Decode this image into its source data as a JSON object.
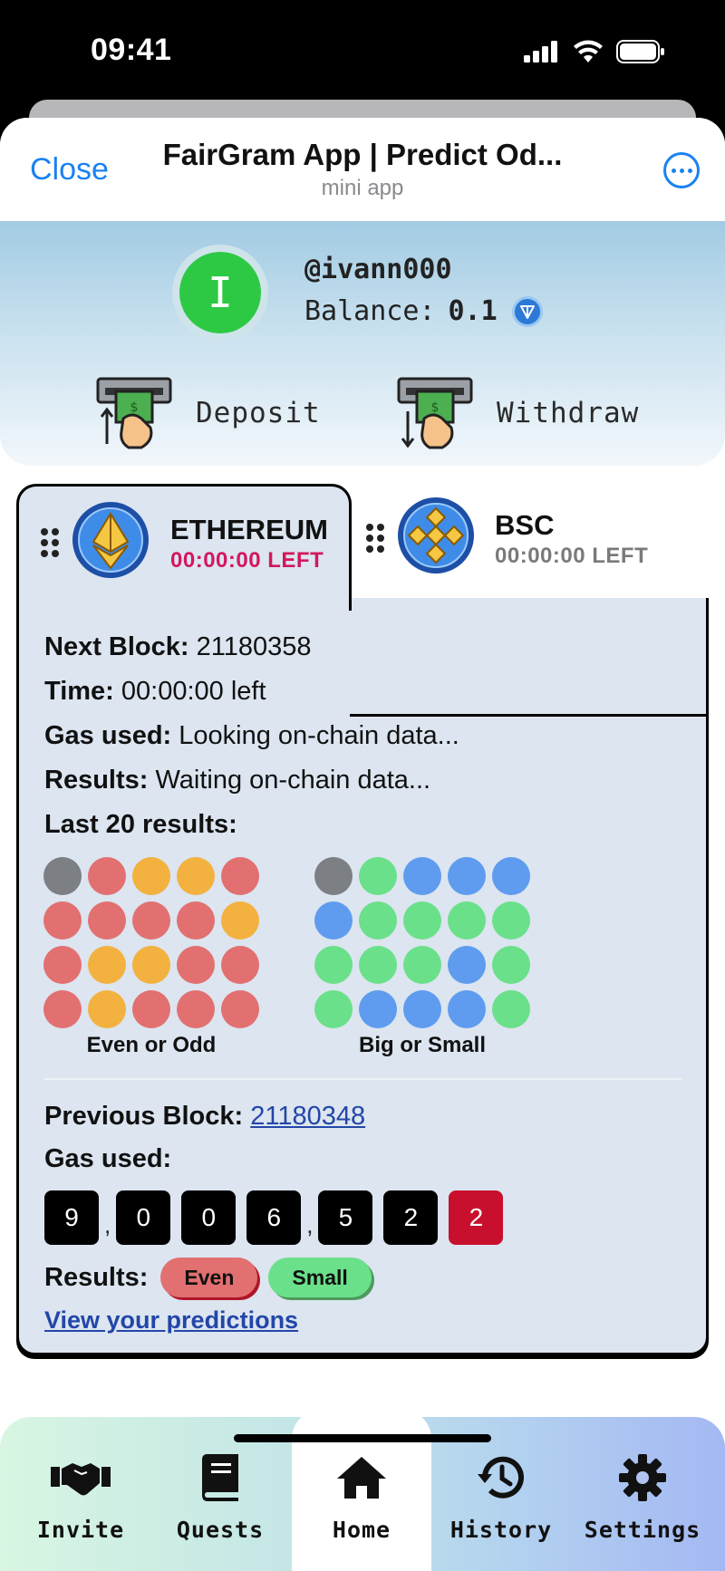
{
  "status_bar": {
    "time": "09:41"
  },
  "header": {
    "close_label": "Close",
    "title": "FairGram App | Predict Od...",
    "subtitle": "mini app",
    "more_icon": "ellipsis-circle-icon"
  },
  "profile": {
    "avatar_initial": "I",
    "username": "@ivann000",
    "balance_label": "Balance:",
    "balance_value": "0.1",
    "deposit_label": "Deposit",
    "withdraw_label": "Withdraw"
  },
  "chains": {
    "active": {
      "name": "ETHEREUM",
      "time_left": "00:00:00 LEFT"
    },
    "inactive": {
      "name": "BSC",
      "time_left": "00:00:00 LEFT"
    }
  },
  "current": {
    "next_block_label": "Next Block:",
    "next_block_value": "21180358",
    "time_label": "Time:",
    "time_value": "00:00:00 left",
    "gas_label": "Gas used:",
    "gas_value": "Looking on-chain data...",
    "results_label": "Results:",
    "results_value": "Waiting on-chain data...",
    "last_label": "Last 20 results:"
  },
  "history": {
    "even_odd": {
      "caption": "Even or Odd",
      "dots": [
        "gray",
        "red",
        "orange",
        "orange",
        "red",
        "red",
        "red",
        "red",
        "red",
        "orange",
        "red",
        "orange",
        "orange",
        "red",
        "red",
        "red",
        "orange",
        "red",
        "red",
        "red"
      ]
    },
    "big_small": {
      "caption": "Big or Small",
      "dots": [
        "gray",
        "green",
        "blue",
        "blue",
        "blue",
        "blue",
        "green",
        "green",
        "green",
        "green",
        "green",
        "green",
        "green",
        "blue",
        "green",
        "green",
        "blue",
        "blue",
        "blue",
        "green"
      ]
    }
  },
  "previous": {
    "block_label": "Previous Block:",
    "block_value": "21180348",
    "gas_label": "Gas used:",
    "gas_digits": [
      "9",
      "0",
      "0",
      "6",
      "5",
      "2",
      "2"
    ],
    "results_label": "Results:",
    "result_even": "Even",
    "result_small": "Small",
    "view_link": "View your predictions"
  },
  "nav": [
    {
      "label": "Invite",
      "icon": "handshake-icon"
    },
    {
      "label": "Quests",
      "icon": "book-icon"
    },
    {
      "label": "Home",
      "icon": "home-icon",
      "active": true
    },
    {
      "label": "History",
      "icon": "history-icon"
    },
    {
      "label": "Settings",
      "icon": "gear-icon"
    }
  ],
  "colors": {
    "red": "#e27070",
    "orange": "#f3b23f",
    "gray": "#7c7f83",
    "green": "#6be08a",
    "blue": "#5f9cef",
    "accent": "#1a82f0",
    "pink": "#d2185c"
  }
}
